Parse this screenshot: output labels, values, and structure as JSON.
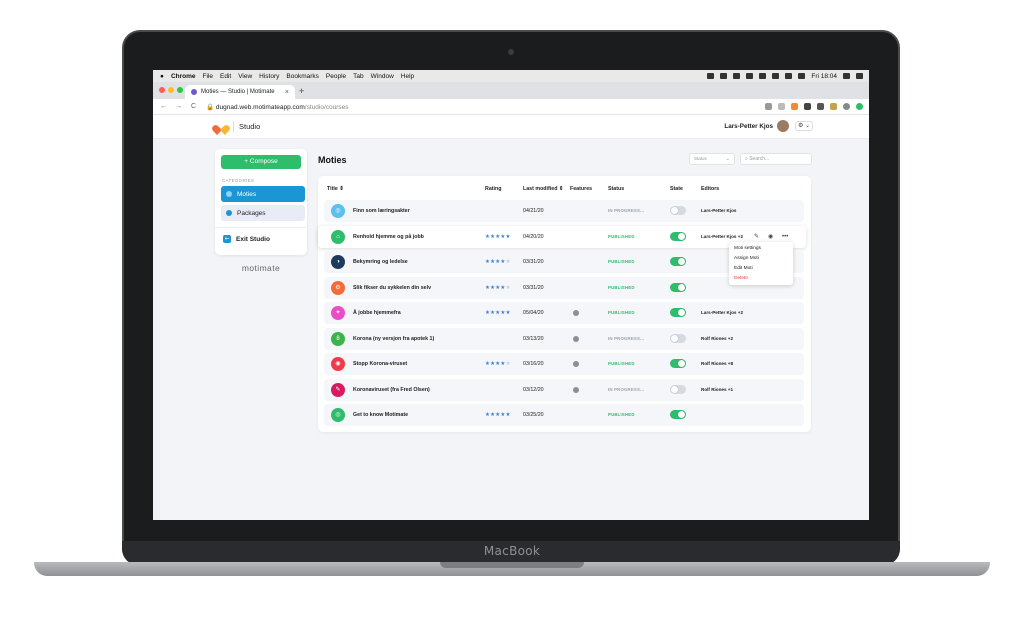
{
  "device": {
    "brand": "MacBook"
  },
  "menubar": {
    "apple": "",
    "items": [
      "Chrome",
      "File",
      "Edit",
      "View",
      "History",
      "Bookmarks",
      "People",
      "Tab",
      "Window",
      "Help"
    ],
    "clock": "Fri 18:04"
  },
  "browser": {
    "tab_title": "Moties — Studio | Motimate",
    "tab_close": "×",
    "new_tab": "+",
    "url_host": "dugnad.web.motimateapp.com",
    "url_path": "/studio/courses",
    "nav": [
      "←",
      "→",
      "C"
    ]
  },
  "header": {
    "studio_label": "Studio",
    "user_name": "Lars-Petter Kjos",
    "settings_icon": "⚙ ⌄"
  },
  "sidebar": {
    "compose_label": "+  Compose",
    "categories_label": "CATEGORIES",
    "items": [
      {
        "label": "Moties",
        "active": true
      },
      {
        "label": "Packages",
        "active": false
      }
    ],
    "exit_label": "Exit Studio",
    "wordmark": "motimate"
  },
  "main": {
    "title": "Moties",
    "status_filter": "Status",
    "search_placeholder": "Search...",
    "columns": {
      "title": "Title ⇕",
      "rating": "Rating",
      "modified": "Last modified ⇕",
      "features": "Features",
      "status": "Status",
      "state": "State",
      "editors": "Editors"
    },
    "rows": [
      {
        "title": "Finn som læringsakter",
        "rating": 0,
        "modified": "04/21/20",
        "feature": false,
        "status": "IN PROGRESS...",
        "published": false,
        "enabled": false,
        "editors": "Lars-Petter Kjos",
        "icon_color": "#5bc0eb",
        "icon": "◎"
      },
      {
        "title": "Renhold hjemme og på jobb",
        "rating": 4.5,
        "modified": "04/20/20",
        "feature": false,
        "status": "PUBLISHED",
        "published": true,
        "enabled": true,
        "editors": "Lars-Petter Kjos +2",
        "icon_color": "#2ebd6b",
        "icon": "⌂"
      },
      {
        "title": "Bekymring og ledelse",
        "rating": 4,
        "modified": "03/31/20",
        "feature": false,
        "status": "PUBLISHED",
        "published": true,
        "enabled": true,
        "editors": "",
        "icon_color": "#1f3b5b",
        "icon": "◑"
      },
      {
        "title": "Slik fikser du sykkelen din selv",
        "rating": 3.5,
        "modified": "03/31/20",
        "feature": false,
        "status": "PUBLISHED",
        "published": true,
        "enabled": true,
        "editors": "",
        "icon_color": "#f26b3a",
        "icon": "⚙"
      },
      {
        "title": "Å jobbe hjemmefra",
        "rating": 4.5,
        "modified": "05/04/20",
        "feature": true,
        "status": "PUBLISHED",
        "published": true,
        "enabled": true,
        "editors": "Lars-Petter Kjos +2",
        "icon_color": "#e84fc7",
        "icon": "✦"
      },
      {
        "title": "Korona (ny versjon fra apotek 1)",
        "rating": 0,
        "modified": "03/13/20",
        "feature": true,
        "status": "IN PROGRESS...",
        "published": false,
        "enabled": false,
        "editors": "Rolf Riones +2",
        "icon_color": "#3bb54a",
        "icon": "8"
      },
      {
        "title": "Stopp Korona-viruset",
        "rating": 4,
        "modified": "03/16/20",
        "feature": true,
        "status": "PUBLISHED",
        "published": true,
        "enabled": true,
        "editors": "Rolf Riones +8",
        "icon_color": "#ef3b48",
        "icon": "◉"
      },
      {
        "title": "Koronaviruset (fra Fred Olsen)",
        "rating": 0,
        "modified": "03/12/20",
        "feature": true,
        "status": "IN PROGRESS...",
        "published": false,
        "enabled": false,
        "editors": "Rolf Riones +1",
        "icon_color": "#d81b60",
        "icon": "✎"
      },
      {
        "title": "Get to know Motimate",
        "rating": 4.5,
        "modified": "03/25/20",
        "feature": false,
        "status": "PUBLISHED",
        "published": true,
        "enabled": true,
        "editors": "",
        "icon_color": "#2ebd6b",
        "icon": "◎"
      }
    ],
    "row_actions": {
      "edit": "✎",
      "view": "◉",
      "more": "•••"
    },
    "context_menu": [
      "Moti settings",
      "Assign Moti",
      "Edit Moti",
      "Delete"
    ]
  },
  "colors": {
    "accent": "#1a96d4",
    "compose": "#2ebd6b",
    "published": "#2ebd6b",
    "in_progress": "#9aa0aa",
    "toggle_on": "#2ebd6b",
    "toggle_off": "#d5d9e0"
  }
}
